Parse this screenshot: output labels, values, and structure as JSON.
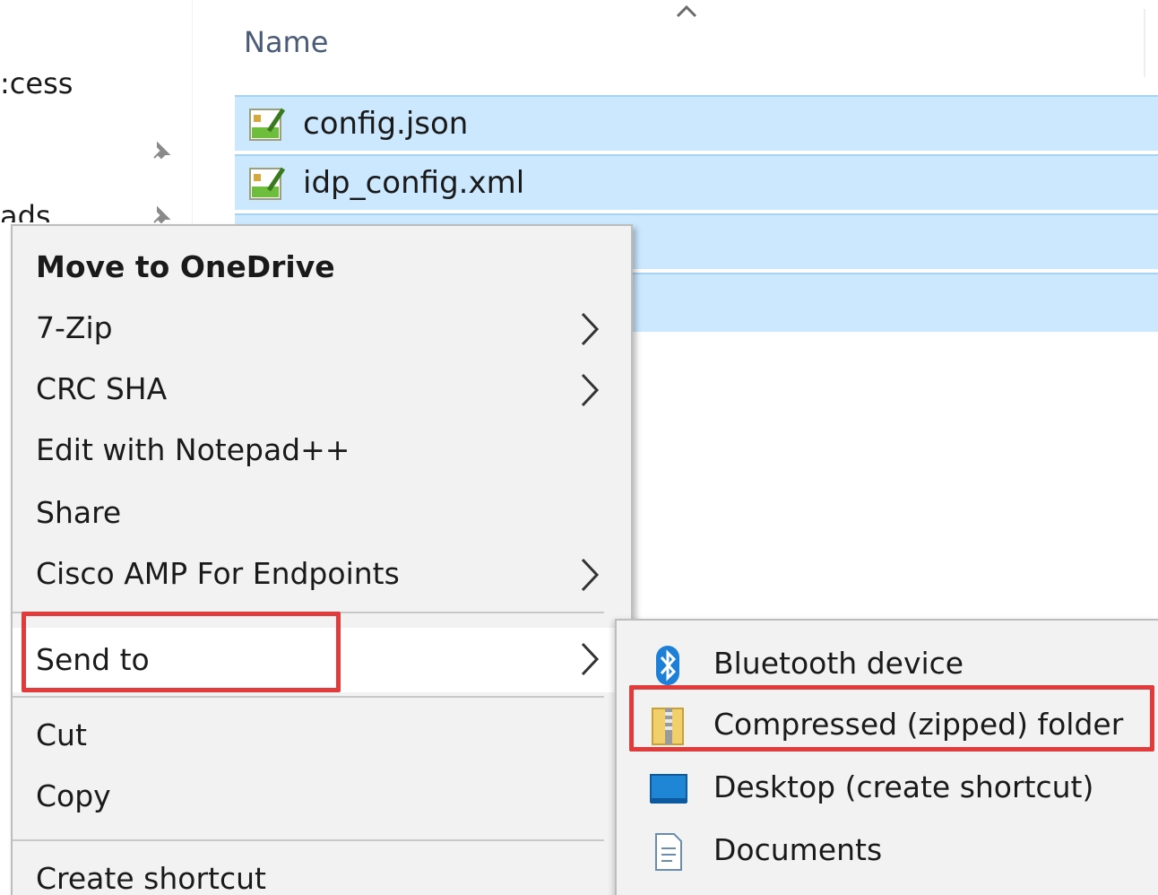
{
  "nav": {
    "items": [
      ":cess",
      "",
      "ads"
    ]
  },
  "file_list": {
    "column_header": "Name",
    "files": [
      "config.json",
      "idp_config.xml",
      "",
      ""
    ]
  },
  "context_menu": {
    "items": [
      {
        "label": "Move to OneDrive",
        "bold": true,
        "submenu": false
      },
      {
        "label": "7-Zip",
        "submenu": true
      },
      {
        "label": "CRC SHA",
        "submenu": true
      },
      {
        "label": "Edit with Notepad++",
        "submenu": false
      },
      {
        "label": "Share",
        "submenu": false
      },
      {
        "label": "Cisco AMP For Endpoints",
        "submenu": true
      },
      {
        "label": "Send to",
        "submenu": true,
        "highlighted": true
      },
      {
        "label": "Cut",
        "submenu": false
      },
      {
        "label": "Copy",
        "submenu": false
      },
      {
        "label": "Create shortcut",
        "submenu": false
      }
    ]
  },
  "send_to_menu": {
    "items": [
      {
        "label": "Bluetooth device",
        "icon": "bluetooth-icon"
      },
      {
        "label": "Compressed (zipped) folder",
        "icon": "zip-folder-icon",
        "highlighted": true
      },
      {
        "label": "Desktop (create shortcut)",
        "icon": "desktop-icon"
      },
      {
        "label": "Documents",
        "icon": "documents-icon"
      }
    ]
  },
  "colors": {
    "selection": "#cce8ff",
    "selection_border": "#a6d2f5",
    "menu_bg": "#f2f2f2",
    "highlight_box": "#e23b3b",
    "header_text": "#4a5b78"
  }
}
